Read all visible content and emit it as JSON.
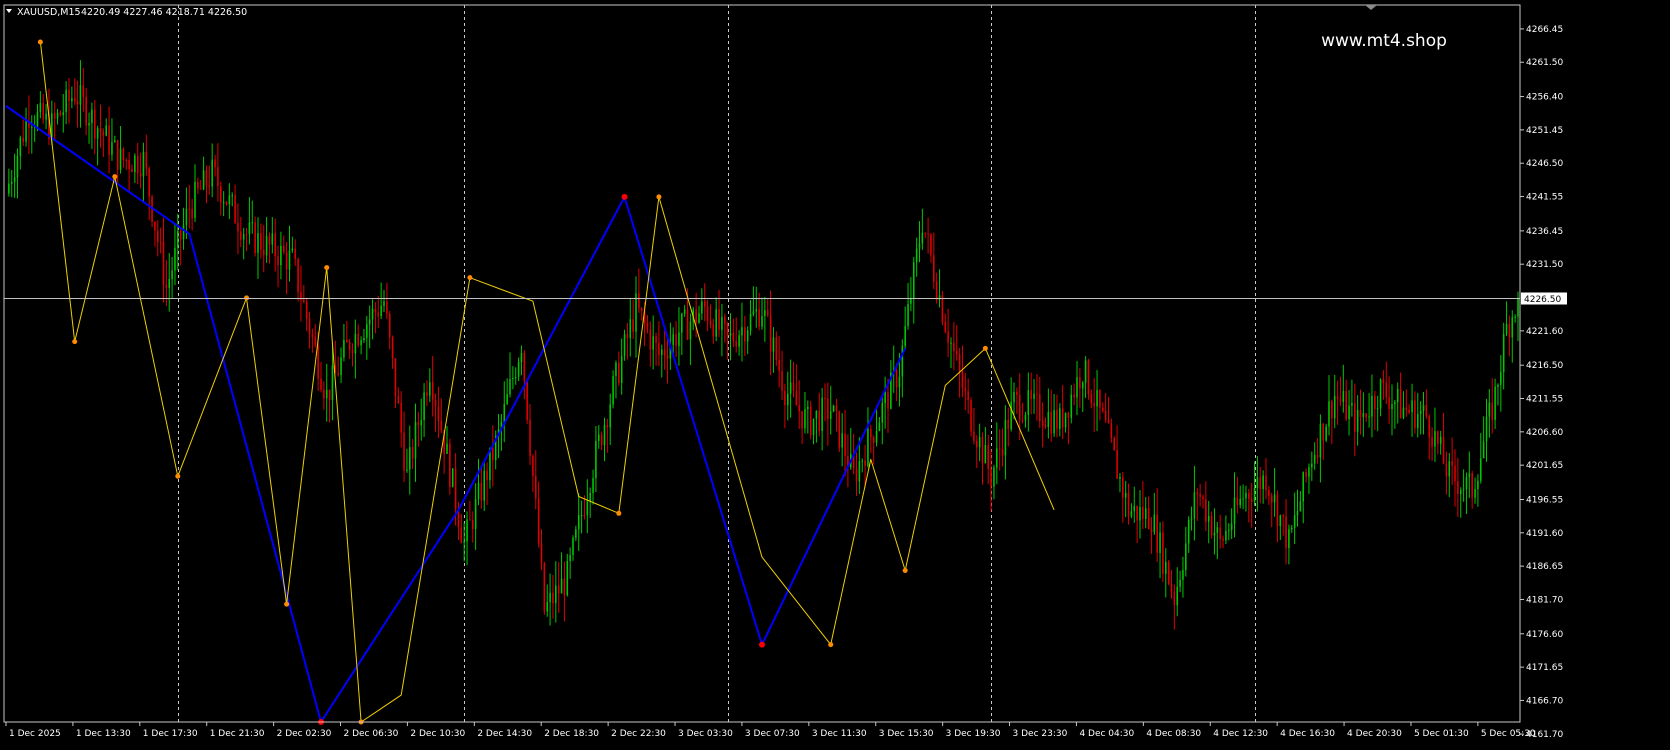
{
  "header": {
    "symbol_label": "XAUUSD,M15",
    "ohlc": "4220.49 4227.46 4218.71 4226.50"
  },
  "watermark": "www.mt4.shop",
  "colors": {
    "background": "#000000",
    "frame": "#c8c8c8",
    "bull": "#00c800",
    "bear": "#e00000",
    "zigzag_major": "#0000ff",
    "zigzag_minor": "#f0d000",
    "pivot_major": "#ff0000",
    "pivot_minor": "#ff8c00",
    "price_line": "#c0c0c0"
  },
  "chart_data": {
    "type": "candlestick",
    "symbol": "XAUUSD",
    "timeframe": "M15",
    "ylim": [
      4163.5,
      4270.0
    ],
    "y_ticks": [
      4266.45,
      4261.5,
      4256.4,
      4251.45,
      4246.5,
      4241.55,
      4236.45,
      4231.5,
      4221.6,
      4216.5,
      4211.55,
      4206.6,
      4201.65,
      4196.55,
      4191.6,
      4186.65,
      4181.7,
      4176.6,
      4171.65,
      4166.7,
      4161.7
    ],
    "current_price": 4226.5,
    "x_ticks": [
      "1 Dec 2025",
      "1 Dec 13:30",
      "1 Dec 17:30",
      "1 Dec 21:30",
      "2 Dec 02:30",
      "2 Dec 06:30",
      "2 Dec 10:30",
      "2 Dec 14:30",
      "2 Dec 18:30",
      "2 Dec 22:30",
      "3 Dec 03:30",
      "3 Dec 07:30",
      "3 Dec 11:30",
      "3 Dec 15:30",
      "3 Dec 19:30",
      "3 Dec 23:30",
      "4 Dec 04:30",
      "4 Dec 08:30",
      "4 Dec 12:30",
      "4 Dec 16:30",
      "4 Dec 20:30",
      "5 Dec 01:30",
      "5 Dec 05:30"
    ],
    "x_range": [
      0,
      132
    ],
    "day_separators": [
      15,
      40,
      63,
      86,
      109
    ],
    "price_anchors": [
      [
        0,
        4242
      ],
      [
        2,
        4254
      ],
      [
        4,
        4252
      ],
      [
        6,
        4257
      ],
      [
        8,
        4252
      ],
      [
        10,
        4247
      ],
      [
        12,
        4247
      ],
      [
        14,
        4228
      ],
      [
        16,
        4240
      ],
      [
        18,
        4245
      ],
      [
        21,
        4236
      ],
      [
        25,
        4232
      ],
      [
        28,
        4212
      ],
      [
        30,
        4220
      ],
      [
        33,
        4226
      ],
      [
        35,
        4200
      ],
      [
        37,
        4216
      ],
      [
        40,
        4190
      ],
      [
        43,
        4206
      ],
      [
        45,
        4220
      ],
      [
        47,
        4180
      ],
      [
        49,
        4185
      ],
      [
        51,
        4200
      ],
      [
        53,
        4213
      ],
      [
        55,
        4225
      ],
      [
        57,
        4218
      ],
      [
        59,
        4222
      ],
      [
        61,
        4225
      ],
      [
        63,
        4220
      ],
      [
        66,
        4225
      ],
      [
        68,
        4213
      ],
      [
        70,
        4208
      ],
      [
        72,
        4210
      ],
      [
        74,
        4200
      ],
      [
        76,
        4208
      ],
      [
        78,
        4216
      ],
      [
        80,
        4238
      ],
      [
        82,
        4223
      ],
      [
        84,
        4210
      ],
      [
        86,
        4200
      ],
      [
        88,
        4211
      ],
      [
        90,
        4210
      ],
      [
        92,
        4208
      ],
      [
        94,
        4216
      ],
      [
        96,
        4207
      ],
      [
        98,
        4195
      ],
      [
        100,
        4194
      ],
      [
        102,
        4182
      ],
      [
        104,
        4198
      ],
      [
        106,
        4190
      ],
      [
        108,
        4197
      ],
      [
        110,
        4200
      ],
      [
        112,
        4190
      ],
      [
        114,
        4203
      ],
      [
        116,
        4212
      ],
      [
        118,
        4208
      ],
      [
        120,
        4213
      ],
      [
        122,
        4210
      ],
      [
        124,
        4209
      ],
      [
        126,
        4200
      ],
      [
        128,
        4198
      ],
      [
        130,
        4212
      ],
      [
        131,
        4222
      ],
      [
        132,
        4226.5
      ]
    ],
    "zigzag_major": [
      [
        0,
        4255
      ],
      [
        16,
        4236
      ],
      [
        27.5,
        4163.5
      ],
      [
        39.5,
        4195
      ],
      [
        54,
        4241.5
      ],
      [
        66,
        4175
      ],
      [
        78.5,
        4219
      ]
    ],
    "zigzag_minor": [
      [
        3,
        4264.5
      ],
      [
        6,
        4220
      ],
      [
        9.5,
        4244.5
      ],
      [
        15,
        4200
      ],
      [
        21,
        4226.5
      ],
      [
        24.5,
        4181
      ],
      [
        28,
        4231
      ],
      [
        31,
        4163.5
      ],
      [
        34.5,
        4167.5
      ],
      [
        40.5,
        4229.5
      ],
      [
        46,
        4226
      ],
      [
        50,
        4197
      ],
      [
        53.5,
        4194.5
      ],
      [
        57,
        4241.5
      ],
      [
        66,
        4188
      ],
      [
        72,
        4175
      ],
      [
        75.5,
        4202.5
      ],
      [
        78.5,
        4186
      ],
      [
        82,
        4213.5
      ],
      [
        85.5,
        4219
      ],
      [
        91.5,
        4195
      ]
    ],
    "pivots_major": [
      [
        27.5,
        4163.5
      ],
      [
        54,
        4241.5
      ],
      [
        66,
        4175
      ]
    ],
    "pivots_minor": [
      [
        3,
        4264.5
      ],
      [
        6,
        4220
      ],
      [
        9.5,
        4244.5
      ],
      [
        15,
        4200
      ],
      [
        21,
        4226.5
      ],
      [
        24.5,
        4181
      ],
      [
        28,
        4231
      ],
      [
        31,
        4163.5
      ],
      [
        40.5,
        4229.5
      ],
      [
        53.5,
        4194.5
      ],
      [
        57,
        4241.5
      ],
      [
        72,
        4175
      ],
      [
        78.5,
        4186
      ],
      [
        85.5,
        4219
      ]
    ]
  }
}
